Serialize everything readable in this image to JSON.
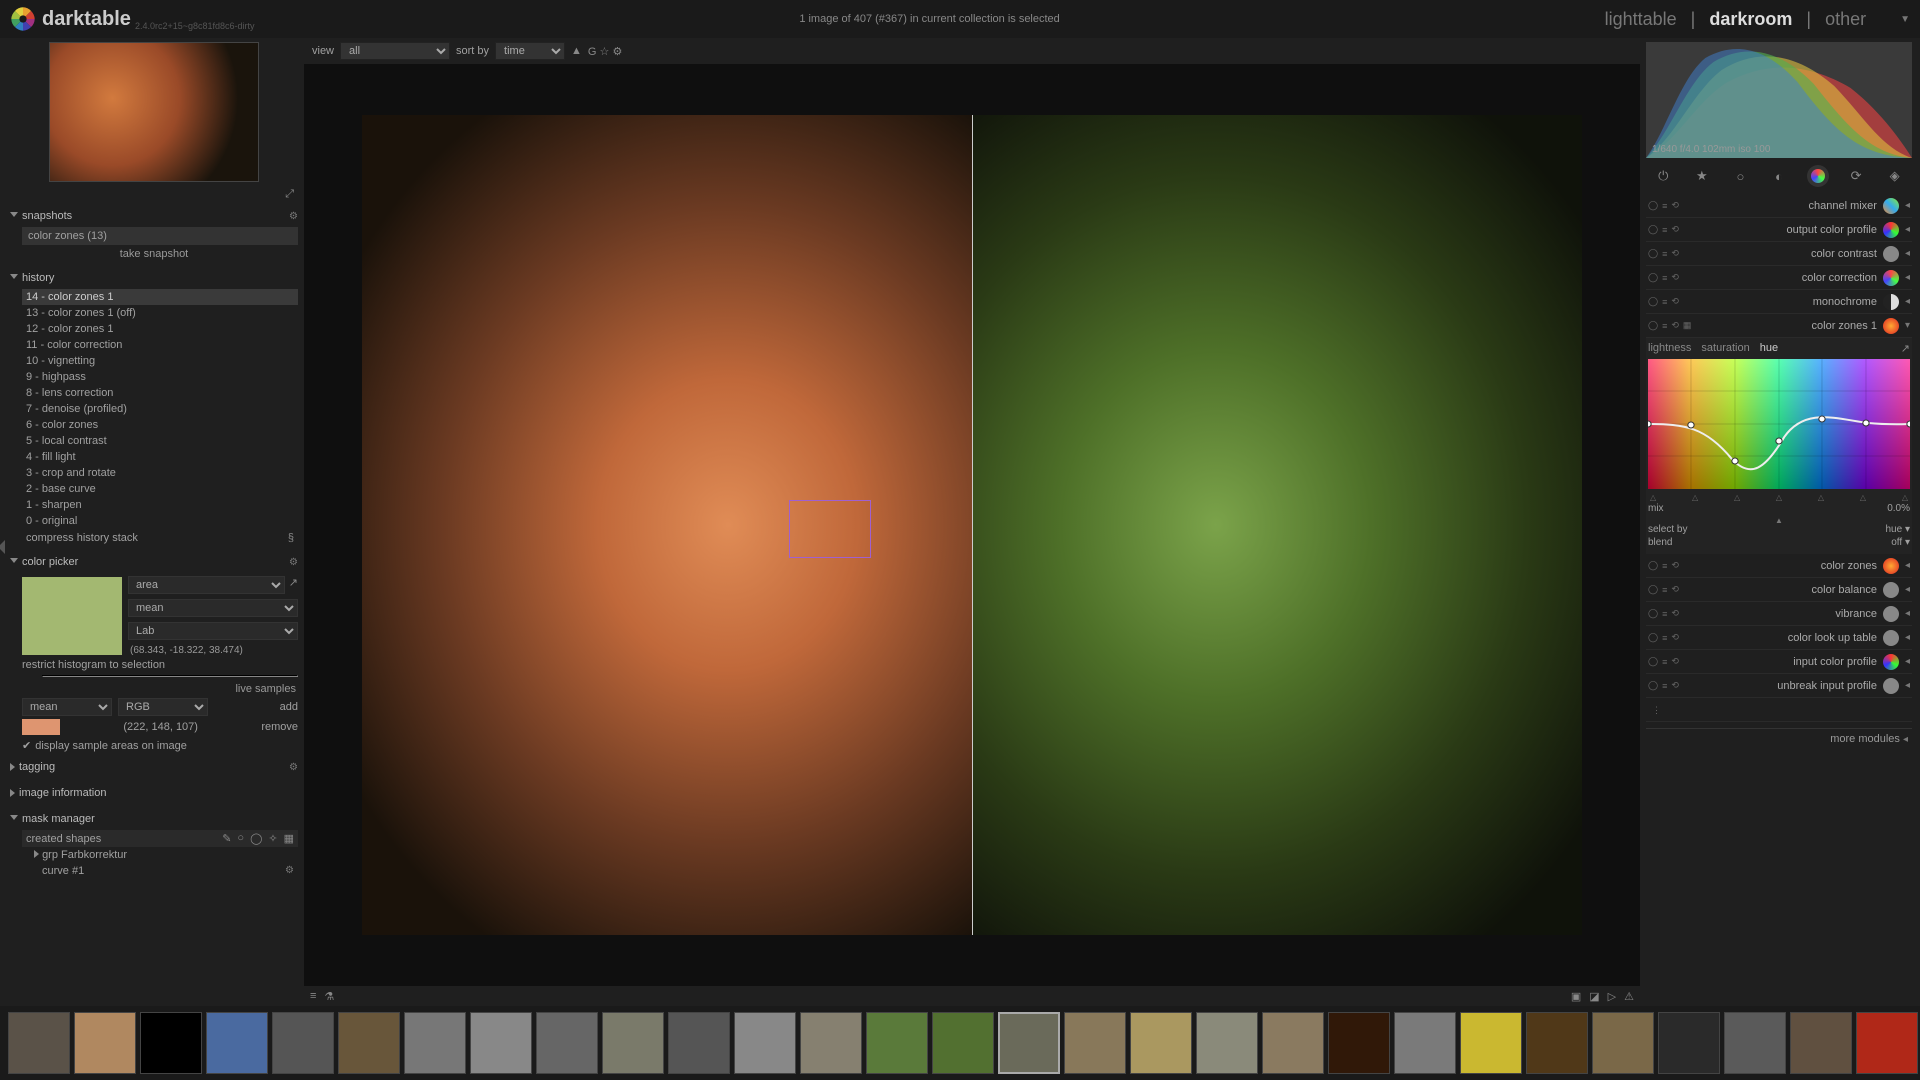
{
  "app": {
    "name": "darktable",
    "version": "2.4.0rc2+15~g8c81fd8c6-dirty"
  },
  "status_line": "1 image of 407 (#367) in current collection is selected",
  "tabs": {
    "lighttable": "lighttable",
    "darkroom": "darkroom",
    "other": "other"
  },
  "view_bar": {
    "view_label": "view",
    "view_value": "all",
    "sort_label": "sort by",
    "sort_value": "time"
  },
  "snapshots": {
    "title": "snapshots",
    "item": "color zones (13)",
    "take": "take snapshot"
  },
  "history": {
    "title": "history",
    "items": [
      "14 - color zones 1",
      "13 - color zones 1 (off)",
      "12 - color zones 1",
      "11 - color correction",
      "10 - vignetting",
      "9 - highpass",
      "8 - lens correction",
      "7 - denoise (profiled)",
      "6 - color zones",
      "5 - local contrast",
      "4 - fill light",
      "3 - crop and rotate",
      "2 - base curve",
      "1 - sharpen",
      "0 - original"
    ],
    "compress": "compress history stack"
  },
  "color_picker": {
    "title": "color picker",
    "mode": "area",
    "stat": "mean",
    "space": "Lab",
    "value_lab": "(68.343, -18.322, 38.474)",
    "restrict": "restrict histogram to selection",
    "live": "live samples",
    "sample_stat": "mean",
    "sample_space": "RGB",
    "add": "add",
    "sample_rgb": "(222, 148, 107)",
    "remove": "remove",
    "display_chk": "display sample areas on image"
  },
  "tagging": {
    "title": "tagging"
  },
  "image_info": {
    "title": "image information"
  },
  "mask": {
    "title": "mask manager",
    "created": "created shapes",
    "grp": "grp Farbkorrektur",
    "curve": "curve #1"
  },
  "exposure_info": "1/640 f/4.0 102mm iso 100",
  "modules": [
    {
      "name": "channel mixer",
      "color": "linear-gradient(45deg,#e83,#3ae,#8e3)"
    },
    {
      "name": "output color profile",
      "color": "conic-gradient(#f33,#3f3,#33f,#f33)"
    },
    {
      "name": "color contrast",
      "color": "#888"
    },
    {
      "name": "color correction",
      "color": "conic-gradient(#f44,#4f4,#44f,#f44)"
    },
    {
      "name": "monochrome",
      "color": "linear-gradient(90deg,#222 50%,#ddd 50%)"
    },
    {
      "name": "color zones 1",
      "color": "radial-gradient(#fa3,#d22)",
      "expanded": true
    }
  ],
  "cz": {
    "tabs": [
      "lightness",
      "saturation",
      "hue"
    ],
    "active": 2,
    "mix_label": "mix",
    "mix_value": "0.0%",
    "select_label": "select by",
    "select_value": "hue",
    "blend_label": "blend",
    "blend_value": "off"
  },
  "modules2": [
    {
      "name": "color zones",
      "color": "radial-gradient(#fa3,#d22)"
    },
    {
      "name": "color balance",
      "color": "#888"
    },
    {
      "name": "vibrance",
      "color": "#888"
    },
    {
      "name": "color look up table",
      "color": "#888"
    },
    {
      "name": "input color profile",
      "color": "conic-gradient(#f33,#3f3,#33f,#f33)"
    },
    {
      "name": "unbreak input profile",
      "color": "#888"
    }
  ],
  "more_modules": "more modules",
  "filmstrip_count": 30,
  "filmstrip_selected": 15,
  "film_colors": [
    "#5a5248",
    "#b08860",
    "#000",
    "#4a6aa0",
    "#555",
    "#68563a",
    "#777",
    "#888",
    "#666",
    "#7a7a6a",
    "#555",
    "#888",
    "#868070",
    "#5a7a3a",
    "#527030",
    "#6a6a5a",
    "#88785a",
    "#aa9860",
    "#8a8a7a",
    "#8a7a60",
    "#301808",
    "#7a7a7a",
    "#cab830",
    "#503818",
    "#7a6848",
    "#2a2a2a",
    "#5a5a5a",
    "#605040",
    "#b02818",
    "#b88828"
  ]
}
